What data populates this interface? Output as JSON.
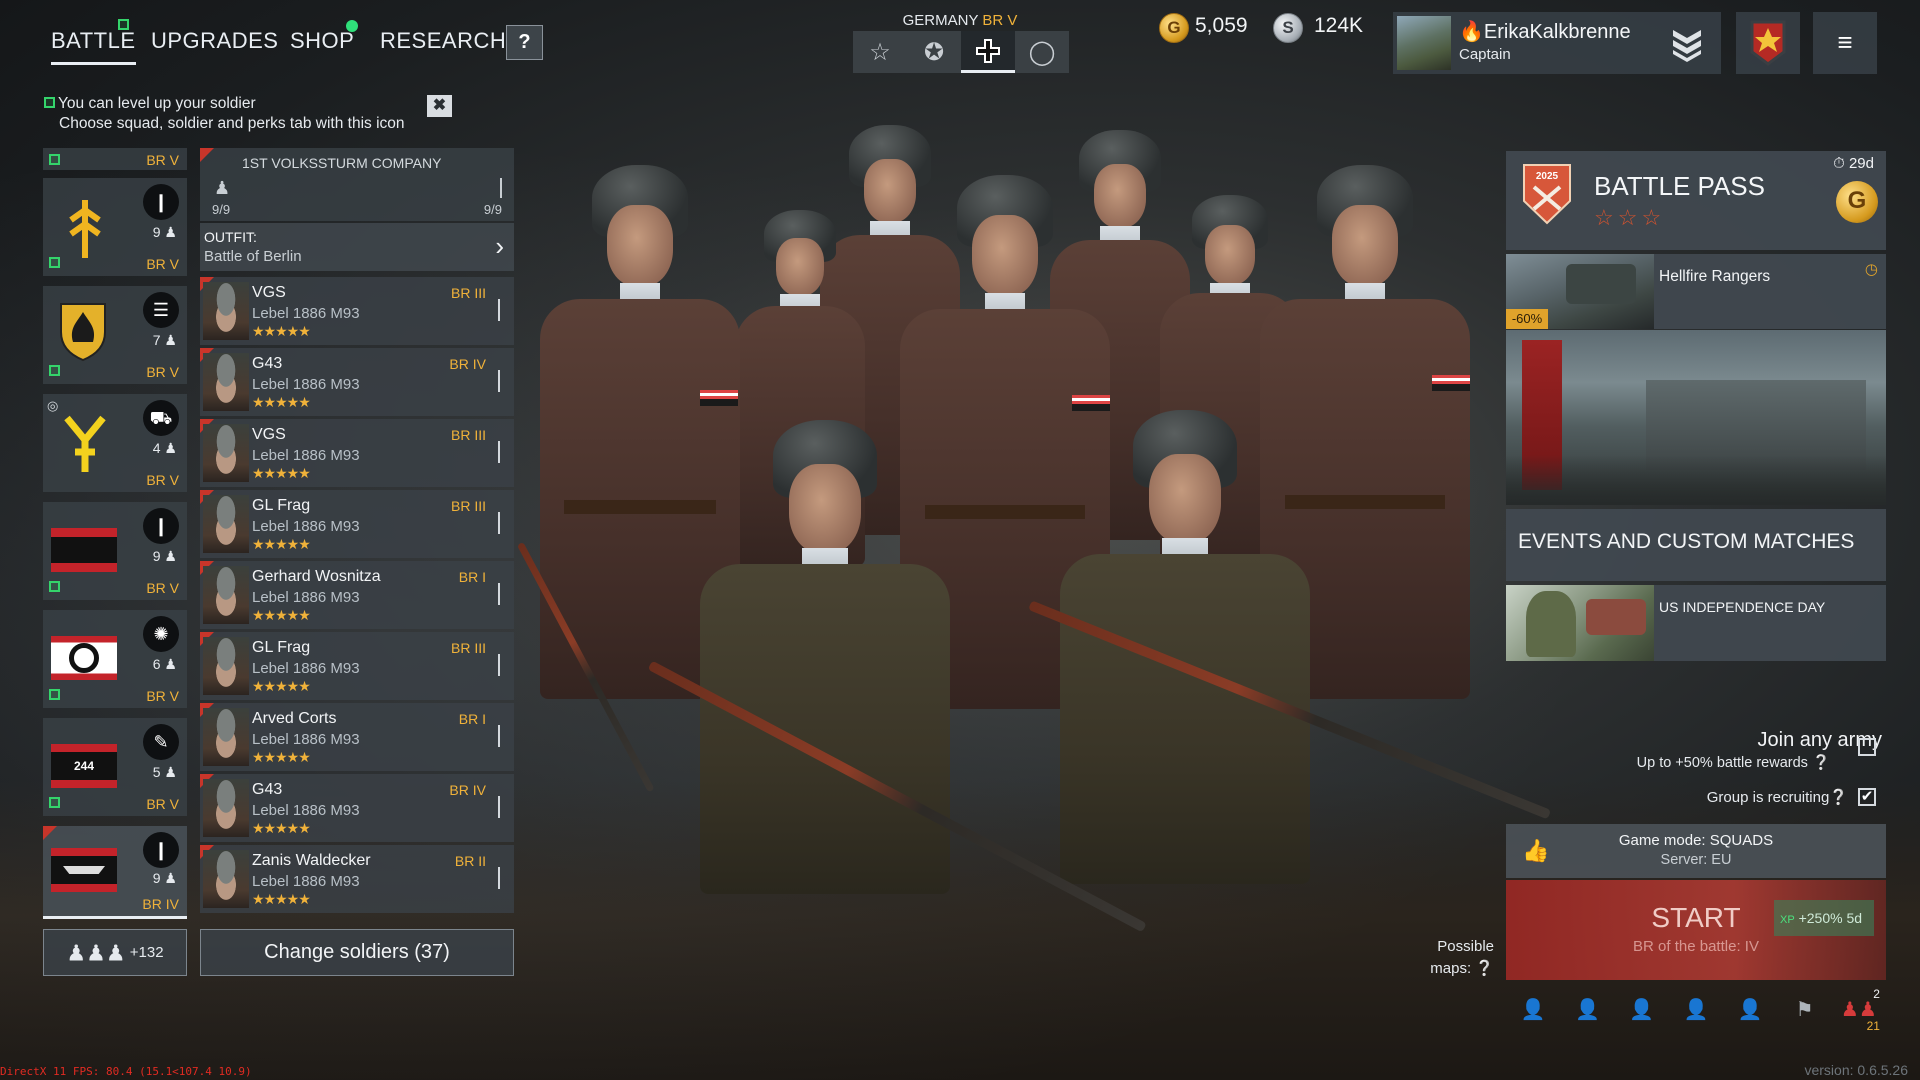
{
  "nav": {
    "tabs": [
      {
        "label": "BATTLE",
        "active": true
      },
      {
        "label": "UPGRADES",
        "active": false
      },
      {
        "label": "SHOP",
        "active": false
      },
      {
        "label": "RESEARCH",
        "active": false
      }
    ],
    "help_label": "?"
  },
  "nation": {
    "name": "GERMANY",
    "br": "BR V",
    "buttons": [
      "star-outline-icon",
      "star-circle-icon",
      "balkenkreuz-icon",
      "ring-icon"
    ],
    "active_index": 2
  },
  "currency": {
    "gold_symbol": "G",
    "gold": "5,059",
    "silver_symbol": "S",
    "silver": "124K"
  },
  "profile": {
    "name": "🔥ErikaKalkbrenne",
    "rank": "Captain"
  },
  "tip": {
    "line1": "You can level up your soldier",
    "line2": "Choose squad, soldier and perks tab with this icon",
    "close": "✖"
  },
  "squads": [
    {
      "br": "BR V",
      "count": "9",
      "emblem": "rune-emblem",
      "type": "infantry"
    },
    {
      "br": "BR V",
      "count": "7",
      "emblem": "flame-shield-emblem",
      "type": "engineer"
    },
    {
      "br": "BR V",
      "count": "4",
      "emblem": "y-rune-emblem",
      "type": "vehicle"
    },
    {
      "br": "BR V",
      "count": "9",
      "emblem": "red-black-band-emblem",
      "type": "infantry"
    },
    {
      "br": "BR V",
      "count": "6",
      "emblem": "wreath-band-emblem",
      "type": "flamethrower"
    },
    {
      "br": "BR V",
      "count": "5",
      "emblem": "244-band-emblem",
      "number": "244",
      "type": "radio"
    },
    {
      "br": "BR IV",
      "count": "9",
      "emblem": "wings-band-emblem",
      "type": "infantry"
    }
  ],
  "first_squad_br": "BR V",
  "company": {
    "name": "1ST VOLKSSTURM COMPANY",
    "left": "9/9",
    "right": "9/9"
  },
  "outfit": {
    "label": "OUTFIT:",
    "value": "Battle of Berlin"
  },
  "soldiers": [
    {
      "name": "VGS",
      "weapon": "Lebel 1886 M93",
      "br": "BR III",
      "stars": "★★★★★"
    },
    {
      "name": "G43",
      "weapon": "Lebel 1886 M93",
      "br": "BR IV",
      "stars": "★★★★★"
    },
    {
      "name": "VGS",
      "weapon": "Lebel 1886 M93",
      "br": "BR III",
      "stars": "★★★★★"
    },
    {
      "name": "GL Frag",
      "weapon": "Lebel 1886 M93",
      "br": "BR III",
      "stars": "★★★★★"
    },
    {
      "name": "Gerhard Wosnitza",
      "weapon": "Lebel 1886 M93",
      "br": "BR I",
      "stars": "★★★★★"
    },
    {
      "name": "GL Frag",
      "weapon": "Lebel 1886 M93",
      "br": "BR III",
      "stars": "★★★★★"
    },
    {
      "name": "Arved Corts",
      "weapon": "Lebel 1886 M93",
      "br": "BR I",
      "stars": "★★★★★"
    },
    {
      "name": "G43",
      "weapon": "Lebel 1886 M93",
      "br": "BR IV",
      "stars": "★★★★★"
    },
    {
      "name": "Zanis Waldecker",
      "weapon": "Lebel 1886 M93",
      "br": "BR II",
      "stars": "★★★★★"
    }
  ],
  "buttons": {
    "soldiers_extra": "+132",
    "change_soldiers": "Change soldiers (37)"
  },
  "battle_pass": {
    "timer": "29d",
    "title": "BATTLE PASS",
    "stars": "☆☆☆",
    "emblem_text": "2025",
    "coin": "G"
  },
  "offer": {
    "title": "Hellfire Rangers",
    "discount": "-60%"
  },
  "events": {
    "title": "EVENTS AND CUSTOM MATCHES",
    "card": "US INDEPENDENCE DAY"
  },
  "options": {
    "join_any": "Join any army",
    "join_sub": "Up to +50% battle rewards",
    "recruiting": "Group is recruiting",
    "recruiting_checked": true,
    "join_checked": false
  },
  "game_mode": {
    "label": "Game mode: SQUADS",
    "server": "Server: EU"
  },
  "start": {
    "label": "START",
    "sub": "BR of the battle: IV",
    "xp": "+250% 5d",
    "xp_tag": "XP"
  },
  "maps": {
    "line1": "Possible",
    "line2": "maps:"
  },
  "party": {
    "count_top": "2",
    "count_bottom": "21"
  },
  "debug": {
    "fps": "DirectX 11 FPS: 80.4 (15.1<107.4 10.9)",
    "version": "version: 0.6.5.26"
  },
  "colors": {
    "accent_gold": "#f0b23a",
    "green": "#34d46b",
    "start_red": "#b43c34"
  }
}
